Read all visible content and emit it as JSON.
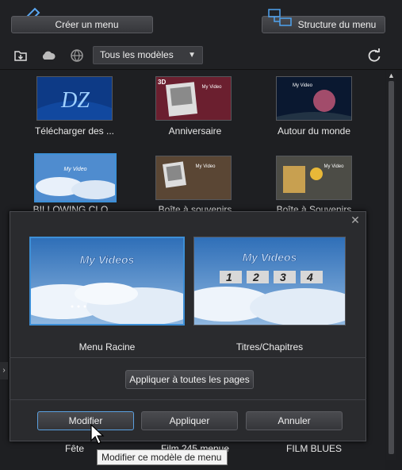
{
  "header": {
    "create_menu_label": "Créer un menu",
    "structure_label": "Structure du menu"
  },
  "toolbar": {
    "filter_value": "Tous les modèles"
  },
  "templates": [
    {
      "label": "Télécharger des ...",
      "thumb_text": "DZ"
    },
    {
      "label": "Anniversaire",
      "thumb_text": "My Video"
    },
    {
      "label": "Autour du monde",
      "thumb_text": "My Video"
    },
    {
      "label": "BILLOWING CLO...",
      "thumb_text": "My Video"
    },
    {
      "label": "Boîte à souvenirs",
      "thumb_text": "My Video"
    },
    {
      "label": "Boîte à Souvenirs",
      "thumb_text": "My Video"
    },
    {
      "label": "Fête"
    },
    {
      "label": "Film 245 menue"
    },
    {
      "label": "FILM BLUES"
    }
  ],
  "dialog": {
    "preview_title": "My Videos",
    "root_menu_label": "Menu Racine",
    "chapters_label": "Titres/Chapitres",
    "chapter_numbers": [
      "1",
      "2",
      "3",
      "4"
    ],
    "apply_all_label": "Appliquer à toutes les pages",
    "modify_label": "Modifier",
    "apply_label": "Appliquer",
    "cancel_label": "Annuler"
  },
  "tooltip": "Modifier ce modèle de menu",
  "colors": {
    "accent_blue": "#3d8fd6",
    "background": "#1d1e21",
    "sky": "#5b8cc4"
  }
}
